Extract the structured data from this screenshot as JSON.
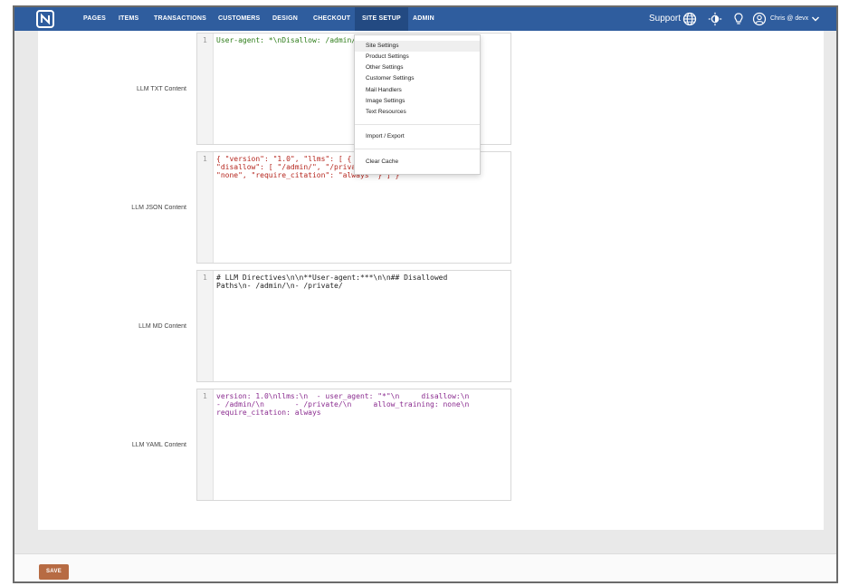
{
  "nav": {
    "items": [
      {
        "label": "PAGES"
      },
      {
        "label": "ITEMS"
      },
      {
        "label": "TRANSACTIONS"
      },
      {
        "label": "CUSTOMERS"
      },
      {
        "label": "DESIGN"
      },
      {
        "label": "CHECKOUT"
      },
      {
        "label": "SITE SETUP"
      },
      {
        "label": "ADMIN"
      }
    ],
    "active": "SITE SETUP",
    "support_label": "Support",
    "user_label": "Chris @ devx",
    "icons": {
      "logo": "logo-icon",
      "globe": "globe-icon",
      "theme": "sun-icon",
      "idea": "lightbulb-icon",
      "user": "user-circle-icon",
      "caret": "chevron-down-icon"
    },
    "colors": {
      "bar": "#2f5d9e",
      "active": "#234a82"
    }
  },
  "dropdown": {
    "group1": [
      {
        "label": "Site Settings"
      },
      {
        "label": "Product Settings"
      },
      {
        "label": "Other Settings"
      },
      {
        "label": "Customer Settings"
      },
      {
        "label": "Mail Handlers"
      },
      {
        "label": "Image Settings"
      },
      {
        "label": "Text Resources"
      }
    ],
    "group2": [
      {
        "label": "Import / Export"
      }
    ],
    "group3": [
      {
        "label": "Clear Cache"
      }
    ]
  },
  "fields": [
    {
      "label": "LLM TXT Content",
      "line_number": "1",
      "code": "User-agent: *\\nDisallow: /admin/\\n"
    },
    {
      "label": "LLM JSON Content",
      "line_number": "1",
      "code_line1": "{ \"version\": \"1.0\", \"llms\": [ { \"u",
      "code_line2": "\"disallow\": [ \"/admin/\", \"/private",
      "code_line3": "\"none\", \"require_citation\": \"always\" } ] }"
    },
    {
      "label": "LLM MD Content",
      "line_number": "1",
      "code_line1": "# LLM Directives\\n\\n**User-agent:***\\n\\n## Disallowed",
      "code_line2": "Paths\\n- /admin/\\n- /private/"
    },
    {
      "label": "LLM YAML Content",
      "line_number": "1",
      "code_line1": "version: 1.0\\nllms:\\n  - user_agent: \"*\"\\n     disallow:\\n",
      "code_line2": "- /admin/\\n       - /private/\\n     allow_training: none\\n",
      "code_line3": "require_citation: always"
    }
  ],
  "footer": {
    "save_label": "SAVE",
    "save_color": "#b76b43"
  }
}
